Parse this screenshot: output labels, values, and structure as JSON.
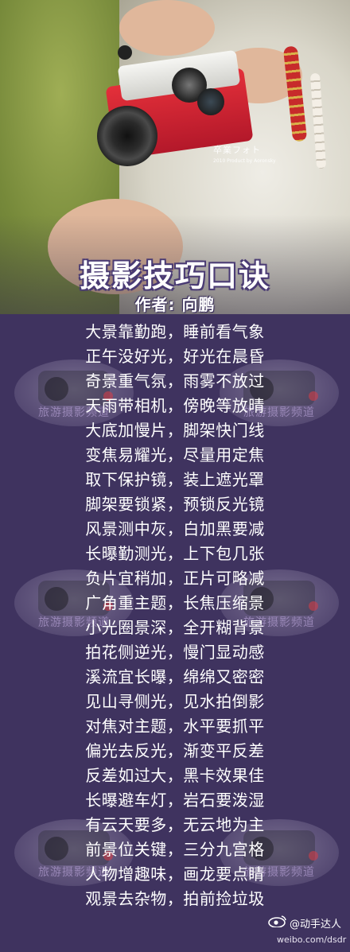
{
  "hero": {
    "watermark_line1": "卒業フォト",
    "watermark_line2": "2010 Product by Aoronsky"
  },
  "title": "摄影技巧口诀",
  "author": "作者: 向鹏",
  "stamp_label": "旅游摄影频道",
  "poem": [
    "大景靠勤跑，睡前看气象",
    "正午没好光，好光在晨昏",
    "奇景重气氛，雨雾不放过",
    "天雨带相机，傍晚等放晴",
    "大底加慢片，脚架快门线",
    "变焦易耀光，尽量用定焦",
    "取下保护镜，装上遮光罩",
    "脚架要锁紧，预锁反光镜",
    "风景测中灰，白加黑要减",
    "长曝勤测光，上下包几张",
    "负片宜稍加，正片可略减",
    "广角重主题，长焦压缩景",
    "小光圈景深，全开糊背景",
    "拍花侧逆光，慢门显动感",
    "溪流宜长曝，绵绵又密密",
    "见山寻侧光，见水拍倒影",
    "对焦对主题，水平要抓平",
    "偏光去反光，渐变平反差",
    "反差如过大，黑卡效果佳",
    "长曝避车灯，岩石要泼湿",
    "有云天要多，无云地为主",
    "前景位关键，三分九宫格",
    "人物增趣味，画龙要点睛",
    "观景去杂物，拍前捡垃圾"
  ],
  "footer": {
    "weibo_handle": "@动手达人",
    "weibo_url": "weibo.com/dsdr"
  }
}
